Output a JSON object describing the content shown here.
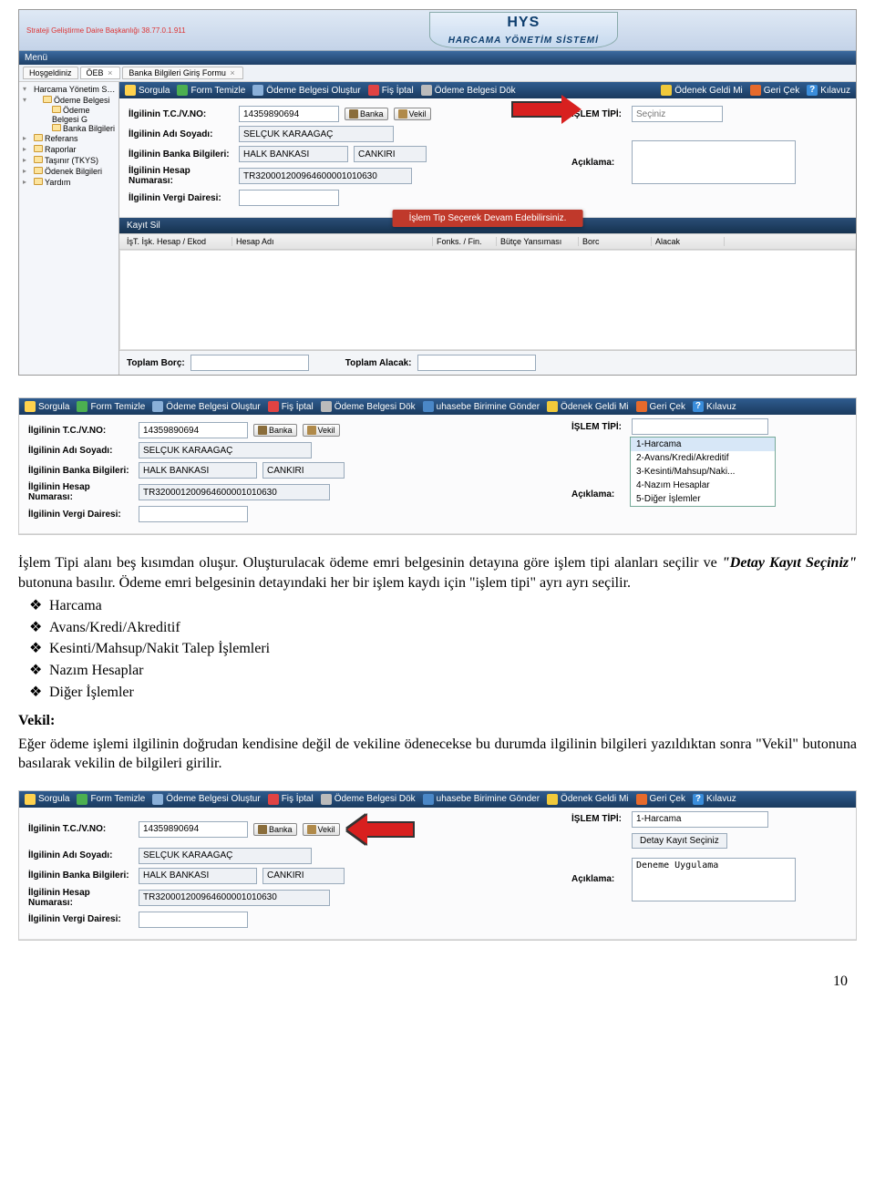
{
  "header": {
    "breadcrumb": "Strateji Geliştirme Daire Başkanlığı 38.77.0.1.911",
    "logo_top": "HYS",
    "logo_sub": "HARCAMA YÖNETİM SİSTEMİ",
    "menu_label": "Menü"
  },
  "tabs": {
    "hosgeldiniz": "Hoşgeldiniz",
    "oeb": "ÖEB",
    "banka_form": "Banka Bilgileri Giriş Formu",
    "close": "×"
  },
  "sidebar": {
    "root": "Harcama Yönetim Sistemi",
    "items": [
      "Ödeme Belgesi",
      "Ödeme Belgesi G",
      "Banka Bilgileri",
      "Referans",
      "Raporlar",
      "Taşınır (TKYS)",
      "Ödenek Bilgileri",
      "Yardım"
    ]
  },
  "toolbar": {
    "sorgula": "Sorgula",
    "temizle": "Form Temizle",
    "olustur": "Ödeme Belgesi Oluştur",
    "fis_iptal": "Fiş İptal",
    "dok": "Ödeme Belgesi Dök",
    "gonder": "uhasebe Birimine Gönder",
    "odenek": "Ödenek Geldi Mi",
    "geri_cek": "Geri Çek",
    "kilavuz": "Kılavuz"
  },
  "form": {
    "tc_label": "İlgilinin T.C./V.NO:",
    "tc_value": "14359890694",
    "banka_btn": "Banka",
    "vekil_btn": "Vekil",
    "ad_label": "İlgilinin Adı Soyadı:",
    "ad_value": "SELÇUK KARAAĞAÇ",
    "bank_label": "İlgilinin Banka Bilgileri:",
    "bank_value": "HALK BANKASI",
    "bank_city": "CANKIRI",
    "hesap_label": "İlgilinin Hesap Numarası:",
    "hesap_value": "TR320001200964600001010630",
    "vergi_label": "İlgilinin Vergi Dairesi:",
    "vergi_value": "",
    "islem_label": "İŞLEM TİPİ:",
    "islem_placeholder": "Seçiniz",
    "aciklama_label": "Açıklama:",
    "detay_btn": "Detay Kayıt Seçiniz",
    "aciklama_value3": "Deneme Uygulama",
    "islem_value3": "1-Harcama"
  },
  "dropdown": {
    "o1": "1-Harcama",
    "o2": "2-Avans/Kredi/Akreditif",
    "o3": "3-Kesinti/Mahsup/Naki...",
    "o4": "4-Nazım Hesaplar",
    "o5": "5-Diğer İşlemler"
  },
  "banner": "İşlem Tip Seçerek Devam Edebilirsiniz.",
  "grid": {
    "kayit_sil": "Kayıt Sil",
    "h1": "İşT. İşk. Hesap / Ekod",
    "h2": "Hesap Adı",
    "h3": "Fonks. / Fin.",
    "h4": "Bütçe Yansıması",
    "h5": "Borc",
    "h6": "Alacak",
    "toplam_borc": "Toplam Borç:",
    "toplam_alacak": "Toplam Alacak:"
  },
  "doc": {
    "p1a": "İşlem Tipi alanı beş kısımdan oluşur. Oluşturulacak ödeme emri belgesinin detayına göre işlem tipi alanları seçilir ve ",
    "p1b": "\"Detay Kayıt Seçiniz\"",
    "p1c": " butonuna basılır. Ödeme emri belgesinin detayındaki her bir işlem kaydı için \"işlem tipi\" ayrı ayrı seçilir.",
    "b1": "Harcama",
    "b2": "Avans/Kredi/Akreditif",
    "b3": "Kesinti/Mahsup/Nakit Talep İşlemleri",
    "b4": "Nazım Hesaplar",
    "b5": "Diğer İşlemler",
    "vekil_hdr": "Vekil:",
    "p2": "Eğer ödeme işlemi ilgilinin doğrudan kendisine değil de vekiline ödenecekse bu durumda ilgilinin bilgileri yazıldıktan sonra \"Vekil\" butonuna basılarak vekilin de bilgileri girilir."
  },
  "page_num": "10"
}
